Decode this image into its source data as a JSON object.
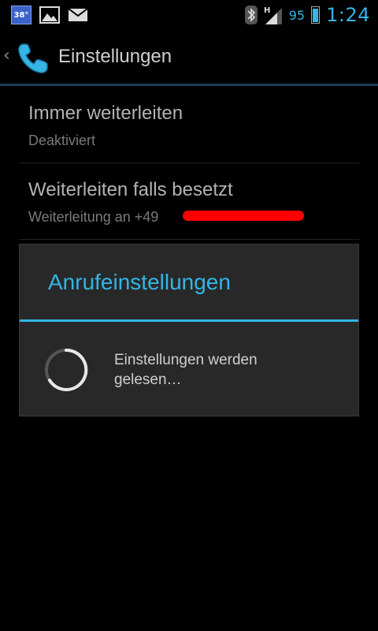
{
  "status_bar": {
    "weather_temp": "38°",
    "battery_percent": "95",
    "battery_level": 0.95,
    "clock": "1:24",
    "network_type": "H",
    "icons": [
      "weather-icon",
      "gallery-icon",
      "mail-icon",
      "bluetooth-icon",
      "signal-icon",
      "battery-icon"
    ]
  },
  "action_bar": {
    "title": "Einstellungen",
    "icon": "phone-icon"
  },
  "preferences": [
    {
      "title": "Immer weiterleiten",
      "summary": "Deaktiviert"
    },
    {
      "title": "Weiterleiten falls besetzt",
      "summary": "Weiterleitung an +49"
    }
  ],
  "dialog": {
    "title": "Anrufeinstellungen",
    "message": "Einstellungen werden gelesen…"
  },
  "colors": {
    "accent": "#33b5e5",
    "redaction": "#ff0000",
    "dialog_bg": "#282828"
  }
}
